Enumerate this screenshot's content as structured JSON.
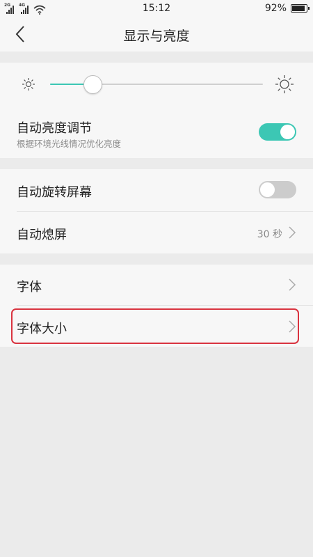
{
  "status_bar": {
    "sim1": "2G",
    "sim2": "4G",
    "time": "15:12",
    "battery_text": "92%",
    "battery_level": 0.92,
    "icons": [
      "signal-icon",
      "signal-icon",
      "wifi-icon",
      "battery-icon"
    ]
  },
  "header": {
    "title": "显示与亮度",
    "back_icon": "chevron-left-icon"
  },
  "brightness": {
    "level": 0.2,
    "low_icon": "sun-small-icon",
    "high_icon": "sun-large-icon",
    "accent_color": "#3cc7b4"
  },
  "auto_brightness": {
    "label": "自动亮度调节",
    "description": "根据环境光线情况优化亮度",
    "enabled": true
  },
  "auto_rotate": {
    "label": "自动旋转屏幕",
    "enabled": false
  },
  "screen_timeout": {
    "label": "自动熄屏",
    "value": "30 秒"
  },
  "font": {
    "label": "字体"
  },
  "font_size": {
    "label": "字体大小",
    "highlight_color": "#d9333f"
  }
}
